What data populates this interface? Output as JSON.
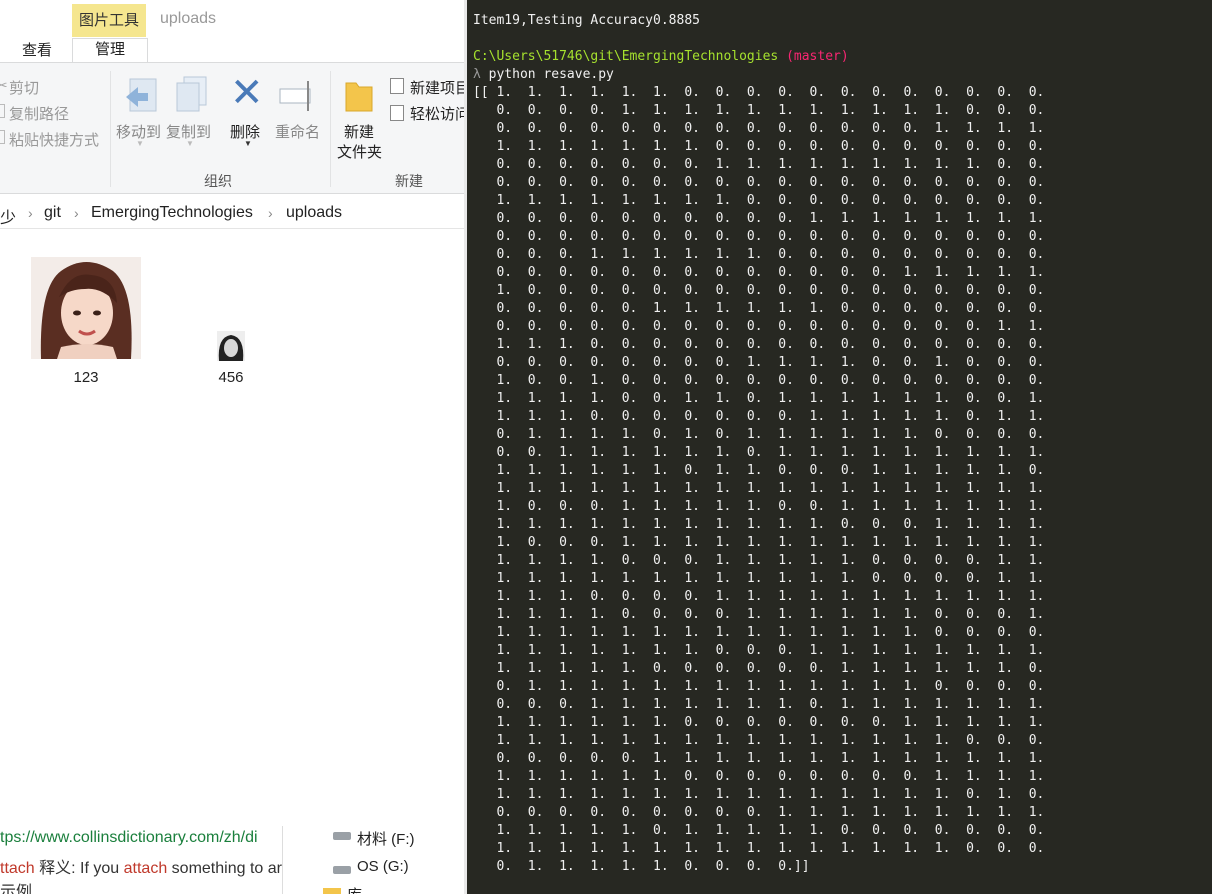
{
  "explorer": {
    "context_tab": "图片工具",
    "window_title": "uploads",
    "tabs": [
      "查看",
      "管理"
    ],
    "clipboard": {
      "cut": "剪切",
      "copy_path": "复制路径",
      "paste_shortcut": "粘贴快捷方式"
    },
    "organize": {
      "move_to": "移动到",
      "copy_to": "复制到",
      "delete": "删除",
      "rename": "重命名",
      "group": "组织"
    },
    "new_group": {
      "new_folder_line1": "新建",
      "new_folder_line2": "文件夹",
      "new_item": "新建项目",
      "easy_access": "轻松访问",
      "group": "新建"
    },
    "breadcrumb": [
      "少",
      "git",
      "EmergingTechnologies",
      "uploads"
    ],
    "files": [
      {
        "name": "123"
      },
      {
        "name": "456"
      }
    ],
    "drives": [
      "材料 (F:)",
      "OS (G:)",
      "库"
    ],
    "web_text": {
      "url": "tps://www.collinsdictionary.com/zh/di",
      "line2_word": "ttach",
      "line2_label": "释义: If you",
      "line2_word2": "attach",
      "line2_rest": "something to ar",
      "line3": "示例."
    }
  },
  "console": {
    "accuracy_line": "Item19,Testing Accuracy0.8885",
    "path": "C:\\Users\\51746\\git\\EmergingTechnologies",
    "branch": "(master)",
    "prompt_symbol": "λ",
    "command": "python resave.py",
    "matrix_rows": [
      "1 1 1 1 1 1 0 0 0 0 0 0 0 0 0 0 0 0",
      "0 0 0 0 1 1 1 1 1 1 1 1 1 1 1 0 0 0",
      "0 0 0 0 0 0 0 0 0 0 0 0 0 0 1 1 1 1",
      "1 1 1 1 1 1 1 0 0 0 0 0 0 0 0 0 0 0",
      "0 0 0 0 0 0 0 1 1 1 1 1 1 1 1 1 0 0",
      "0 0 0 0 0 0 0 0 0 0 0 0 0 0 0 0 0 0",
      "1 1 1 1 1 1 1 1 0 0 0 0 0 0 0 0 0 0",
      "0 0 0 0 0 0 0 0 0 0 1 1 1 1 1 1 1 1",
      "0 0 0 0 0 0 0 0 0 0 0 0 0 0 0 0 0 0",
      "0 0 0 1 1 1 1 1 1 0 0 0 0 0 0 0 0 0",
      "0 0 0 0 0 0 0 0 0 0 0 0 0 1 1 1 1 1",
      "1 0 0 0 0 0 0 0 0 0 0 0 0 0 0 0 0 0",
      "0 0 0 0 0 1 1 1 1 1 1 0 0 0 0 0 0 0",
      "0 0 0 0 0 0 0 0 0 0 0 0 0 0 0 0 1 1",
      "1 1 1 0 0 0 0 0 0 0 0 0 0 0 0 0 0 0",
      "0 0 0 0 0 0 0 0 1 1 1 1 0 0 1 0 0 0",
      "1 0 0 1 0 0 0 0 0 0 0 0 0 0 0 0 0 0",
      "1 1 1 1 0 0 1 1 0 1 1 1 1 1 1 0 0 1",
      "1 1 1 0 0 0 0 0 0 0 1 1 1 1 1 0 1 1",
      "0 1 1 1 1 0 1 0 1 1 1 1 1 1 0 0 0 0",
      "0 0 1 1 1 1 1 1 0 1 1 1 1 1 1 1 1 1",
      "1 1 1 1 1 1 0 1 1 0 0 0 1 1 1 1 1 0",
      "1 1 1 1 1 1 1 1 1 1 1 1 1 1 1 1 1 1",
      "1 0 0 0 1 1 1 1 1 0 0 1 1 1 1 1 1 1",
      "1 1 1 1 1 1 1 1 1 1 1 0 0 0 1 1 1 1",
      "1 0 0 0 1 1 1 1 1 1 1 1 1 1 1 1 1 1",
      "1 1 1 1 0 0 0 1 1 1 1 1 0 0 0 0 1 1",
      "1 1 1 1 1 1 1 1 1 1 1 1 0 0 0 0 1 1",
      "1 1 1 0 0 0 0 1 1 1 1 1 1 1 1 1 1 1",
      "1 1 1 1 0 0 0 0 1 1 1 1 1 1 0 0 0 1",
      "1 1 1 1 1 1 1 1 1 1 1 1 1 1 0 0 0 0",
      "1 1 1 1 1 1 1 0 0 0 1 1 1 1 1 1 1 1",
      "1 1 1 1 1 0 0 0 0 0 0 1 1 1 1 1 1 0",
      "0 1 1 1 1 1 1 1 1 1 1 1 1 1 0 0 0 0",
      "0 0 0 1 1 1 1 1 1 1 0 1 1 1 1 1 1 1",
      "1 1 1 1 1 1 0 0 0 0 0 0 0 1 1 1 1 1",
      "1 1 1 1 1 1 1 1 1 1 1 1 1 1 1 0 0 0",
      "0 0 0 0 0 1 1 1 1 1 1 1 1 1 1 1 1 1",
      "1 1 1 1 1 1 0 0 0 0 0 0 0 0 1 1 1 1",
      "1 1 1 1 1 1 1 1 1 1 1 1 1 1 1 0 1 0",
      "0 0 0 0 0 0 0 0 0 1 1 1 1 1 1 1 1 1",
      "1 1 1 1 1 0 1 1 1 1 1 0 0 0 0 0 0 0",
      "1 1 1 1 1 1 1 1 1 1 1 1 1 1 1 0 0 0",
      "0 1 1 1 1 1 0 0 0 0"
    ]
  }
}
